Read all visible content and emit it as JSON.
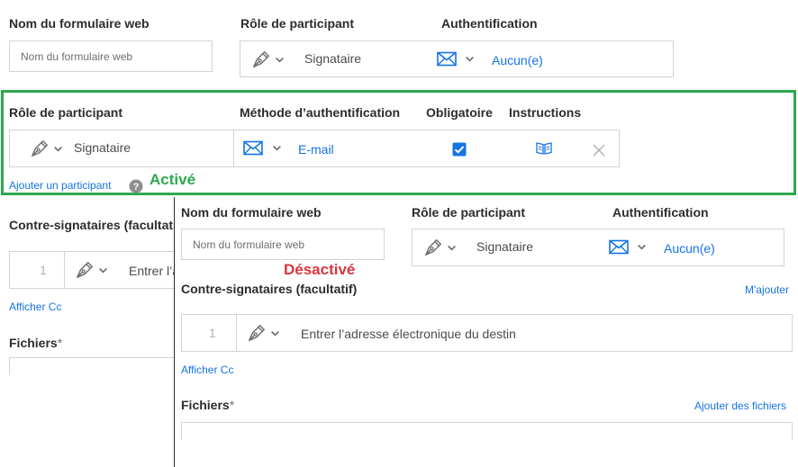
{
  "top": {
    "form_name_label": "Nom du formulaire web",
    "form_name_placeholder": "Nom du formulaire web",
    "role_label": "Rôle de participant",
    "auth_label": "Authentification",
    "role_value": "Signataire",
    "auth_value": "Aucun(e)"
  },
  "active": {
    "role_label": "Rôle de participant",
    "method_label": "Méthode d’authentification",
    "required_label": "Obligatoire",
    "instructions_label": "Instructions",
    "role_value": "Signataire",
    "method_value": "E-mail",
    "add_participant": "Ajouter un participant",
    "state_label": "Activé"
  },
  "left_bg": {
    "cosigners_label": "Contre-signataires (facultatif)",
    "index": "1",
    "input_placeholder": "Entrer l’adresse électronique du destinataire",
    "show_cc": "Afficher Cc",
    "files_label": "Fichiers",
    "asterisk": "*"
  },
  "panel": {
    "form_name_label": "Nom du formulaire web",
    "form_name_placeholder": "Nom du formulaire web",
    "role_label": "Rôle de participant",
    "auth_label": "Authentification",
    "role_value": "Signataire",
    "auth_value": "Aucun(e)",
    "state_label": "Désactivé",
    "cosigners_label": "Contre-signataires (facultatif)",
    "add_me": "M'ajouter",
    "index": "1",
    "input_placeholder": "Entrer l’adresse électronique du destin",
    "show_cc": "Afficher Cc",
    "files_label": "Fichiers",
    "asterisk": "*",
    "add_files": "Ajouter des fichiers"
  },
  "colors": {
    "active": "#2da84e",
    "inactive": "#d7373f",
    "link": "#1473e6",
    "checkbox": "#1473e6"
  },
  "icons": [
    "pen-nib-icon",
    "chevron-down-icon",
    "envelope-icon",
    "book-icon",
    "close-icon",
    "help-icon",
    "checkbox-checked-icon"
  ]
}
